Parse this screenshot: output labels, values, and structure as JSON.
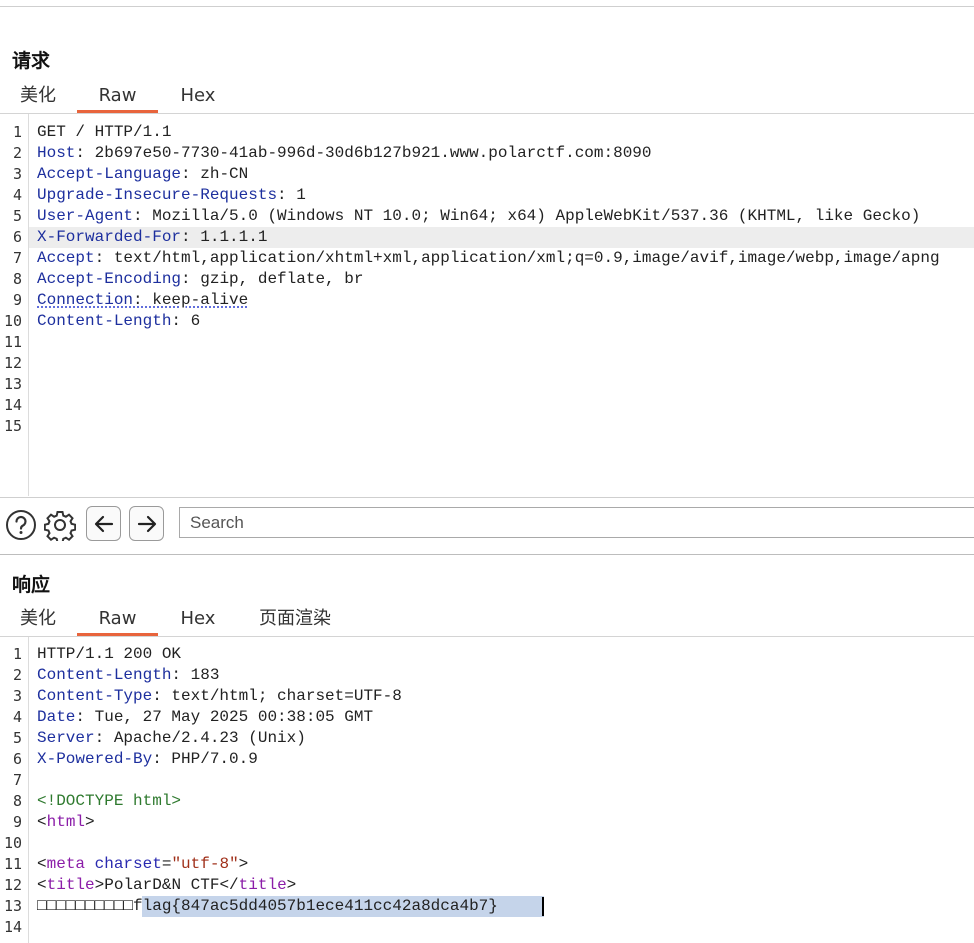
{
  "request": {
    "title": "请求",
    "tabs": [
      "美化",
      "Raw",
      "Hex"
    ],
    "active_tab": "Raw",
    "lines": [
      {
        "n": "1",
        "k": "",
        "v": "GET / HTTP/1.1"
      },
      {
        "n": "2",
        "k": "Host",
        "v": ": 2b697e50-7730-41ab-996d-30d6b127b921.www.polarctf.com:8090"
      },
      {
        "n": "3",
        "k": "Accept-Language",
        "v": ": zh-CN"
      },
      {
        "n": "4",
        "k": "Upgrade-Insecure-Requests",
        "v": ": 1"
      },
      {
        "n": "5",
        "k": "User-Agent",
        "v": ": Mozilla/5.0 (Windows NT 10.0; Win64; x64) AppleWebKit/537.36 (KHTML, like Gecko)"
      },
      {
        "n": "6",
        "k": "X-Forwarded-For",
        "v": ": 1.1.1.1"
      },
      {
        "n": "7",
        "k": "Accept",
        "v": ": text/html,application/xhtml+xml,application/xml;q=0.9,image/avif,image/webp,image/apng"
      },
      {
        "n": "8",
        "k": "Accept-Encoding",
        "v": ": gzip, deflate, br"
      },
      {
        "n": "9",
        "k": "Connection",
        "v": ": keep-alive"
      },
      {
        "n": "10",
        "k": "Content-Length",
        "v": ": 6"
      },
      {
        "n": "11",
        "k": "",
        "v": ""
      },
      {
        "n": "12",
        "k": "",
        "v": ""
      },
      {
        "n": "13",
        "k": "",
        "v": ""
      },
      {
        "n": "14",
        "k": "",
        "v": ""
      },
      {
        "n": "15",
        "k": "",
        "v": ""
      }
    ]
  },
  "toolbar": {
    "help_icon": "help-circle-icon",
    "settings_icon": "gear-icon",
    "back_icon": "arrow-left-icon",
    "forward_icon": "arrow-right-icon",
    "search_placeholder": "Search"
  },
  "response": {
    "title": "响应",
    "tabs": [
      "美化",
      "Raw",
      "Hex",
      "页面渲染"
    ],
    "active_tab": "Raw",
    "status_line": "HTTP/1.1 200 OK",
    "headers": [
      {
        "n": "2",
        "k": "Content-Length",
        "v": ": 183"
      },
      {
        "n": "3",
        "k": "Content-Type",
        "v": ": text/html; charset=UTF-8"
      },
      {
        "n": "4",
        "k": "Date",
        "v": ": Tue, 27 May 2025 00:38:05 GMT"
      },
      {
        "n": "5",
        "k": "Server",
        "v": ": Apache/2.4.23 (Unix)"
      },
      {
        "n": "6",
        "k": "X-Powered-By",
        "v": ": PHP/7.0.9"
      }
    ],
    "line_numbers": [
      "1",
      "2",
      "3",
      "4",
      "5",
      "6",
      "7",
      "8",
      "9",
      "10",
      "11",
      "12",
      "13",
      "14"
    ],
    "doctype": "<!DOCTYPE html>",
    "html_open_tag": "html",
    "meta_tag": "meta",
    "meta_attr": "charset",
    "meta_value": "\"utf-8\"",
    "title_tag": "title",
    "page_title": "PolarD&N CTF",
    "garbled": "□□□□□□□□□□",
    "flag_selected": "flag{847ac5dd4057b1ece411cc42a8dca4b",
    "flag_rest": "7}"
  },
  "colors": {
    "accent_tab_underline": "#e8643c",
    "header_key": "#1d2f9e",
    "selection": "#c5d4ea"
  }
}
